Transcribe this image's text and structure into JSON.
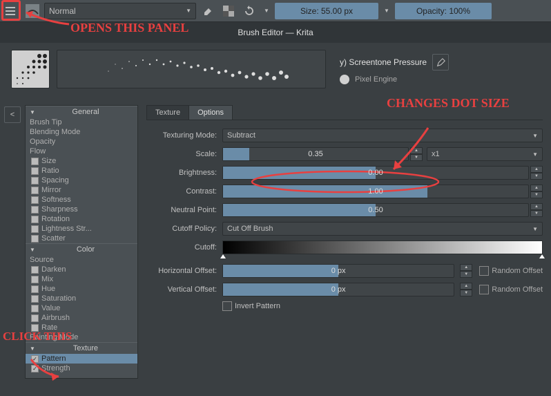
{
  "toolbar": {
    "blend_mode": "Normal",
    "size_label": "Size: 55.00 px",
    "opacity_label": "Opacity: 100%"
  },
  "titlebar": "Brush Editor — Krita",
  "brush": {
    "name": "y) Screentone Pressure",
    "engine": "Pixel Engine"
  },
  "tree": {
    "general_header": "General",
    "general": [
      "Brush Tip",
      "Blending Mode",
      "Opacity",
      "Flow"
    ],
    "general_checks": [
      "Size",
      "Ratio",
      "Spacing",
      "Mirror",
      "Softness",
      "Sharpness",
      "Rotation",
      "Lightness Str...",
      "Scatter"
    ],
    "color_header": "Color",
    "color": [
      "Source"
    ],
    "color_checks": [
      "Darken",
      "Mix",
      "Hue",
      "Saturation",
      "Value",
      "Airbrush",
      "Rate"
    ],
    "painting_mode": "Painting Mode",
    "texture_header": "Texture",
    "texture_checks": [
      "Pattern",
      "Strength"
    ]
  },
  "tabs": {
    "texture": "Texture",
    "options": "Options"
  },
  "options": {
    "texturing_mode_label": "Texturing Mode:",
    "texturing_mode": "Subtract",
    "scale_label": "Scale:",
    "scale_value": "0.35",
    "scale_mult": "x1",
    "brightness_label": "Brightness:",
    "brightness_value": "0.00",
    "contrast_label": "Contrast:",
    "contrast_value": "1.00",
    "neutral_label": "Neutral Point:",
    "neutral_value": "0.50",
    "cutoff_policy_label": "Cutoff Policy:",
    "cutoff_policy": "Cut Off Brush",
    "cutoff_label": "Cutoff:",
    "hoffset_label": "Horizontal Offset:",
    "hoffset_value": "0 px",
    "voffset_label": "Vertical Offset:",
    "voffset_value": "0 px",
    "random_offset": "Random Offset",
    "invert_pattern": "Invert Pattern"
  },
  "annotations": {
    "opens_panel": "OPENS THIS PANEL",
    "changes_dot": "CHANGES DOT SIZE",
    "click_this": "CLICK THIS"
  }
}
